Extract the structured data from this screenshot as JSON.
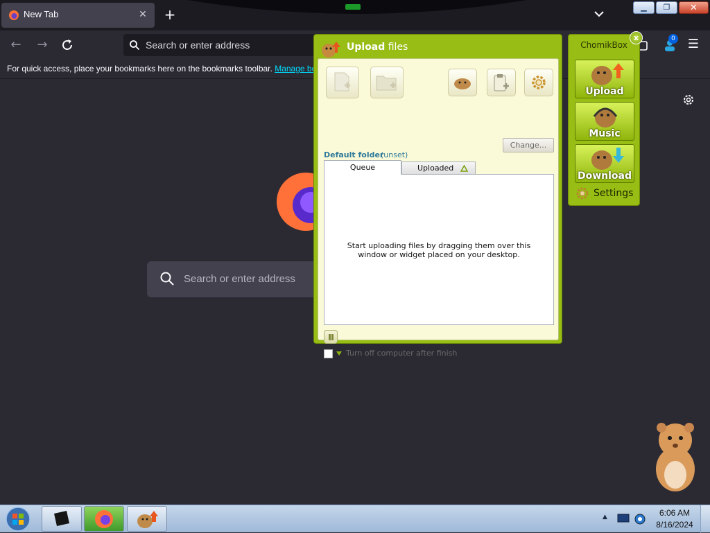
{
  "browser": {
    "tab_title": "New Tab",
    "url_placeholder": "Search or enter address",
    "bookmarks_message": "For quick access, place your bookmarks here on the bookmarks toolbar.",
    "bookmarks_link": "Manage bo",
    "profile_badge": "0",
    "newtab_search_placeholder": "Search or enter address",
    "accent_color": "#00ddff"
  },
  "upload_window": {
    "title_bold": "Upload",
    "title_rest": "files",
    "default_folder_label": "Default folder",
    "default_folder_value": "(unset)",
    "change_button": "Change...",
    "tabs": [
      "Queue",
      "Uploaded"
    ],
    "queue_message": "Start uploading files by dragging them over this window or widget placed on your desktop.",
    "shutdown_label": "Turn off computer after finish",
    "colors": {
      "frame": "#98bd14",
      "body": "#fbfad8",
      "link": "#2e7a9a"
    }
  },
  "chomikbox": {
    "title": "ChomikBox",
    "buttons": [
      "Upload",
      "Music",
      "Download"
    ],
    "settings_label": "Settings"
  },
  "taskbar": {
    "time": "6:06 AM",
    "date": "8/16/2024"
  }
}
